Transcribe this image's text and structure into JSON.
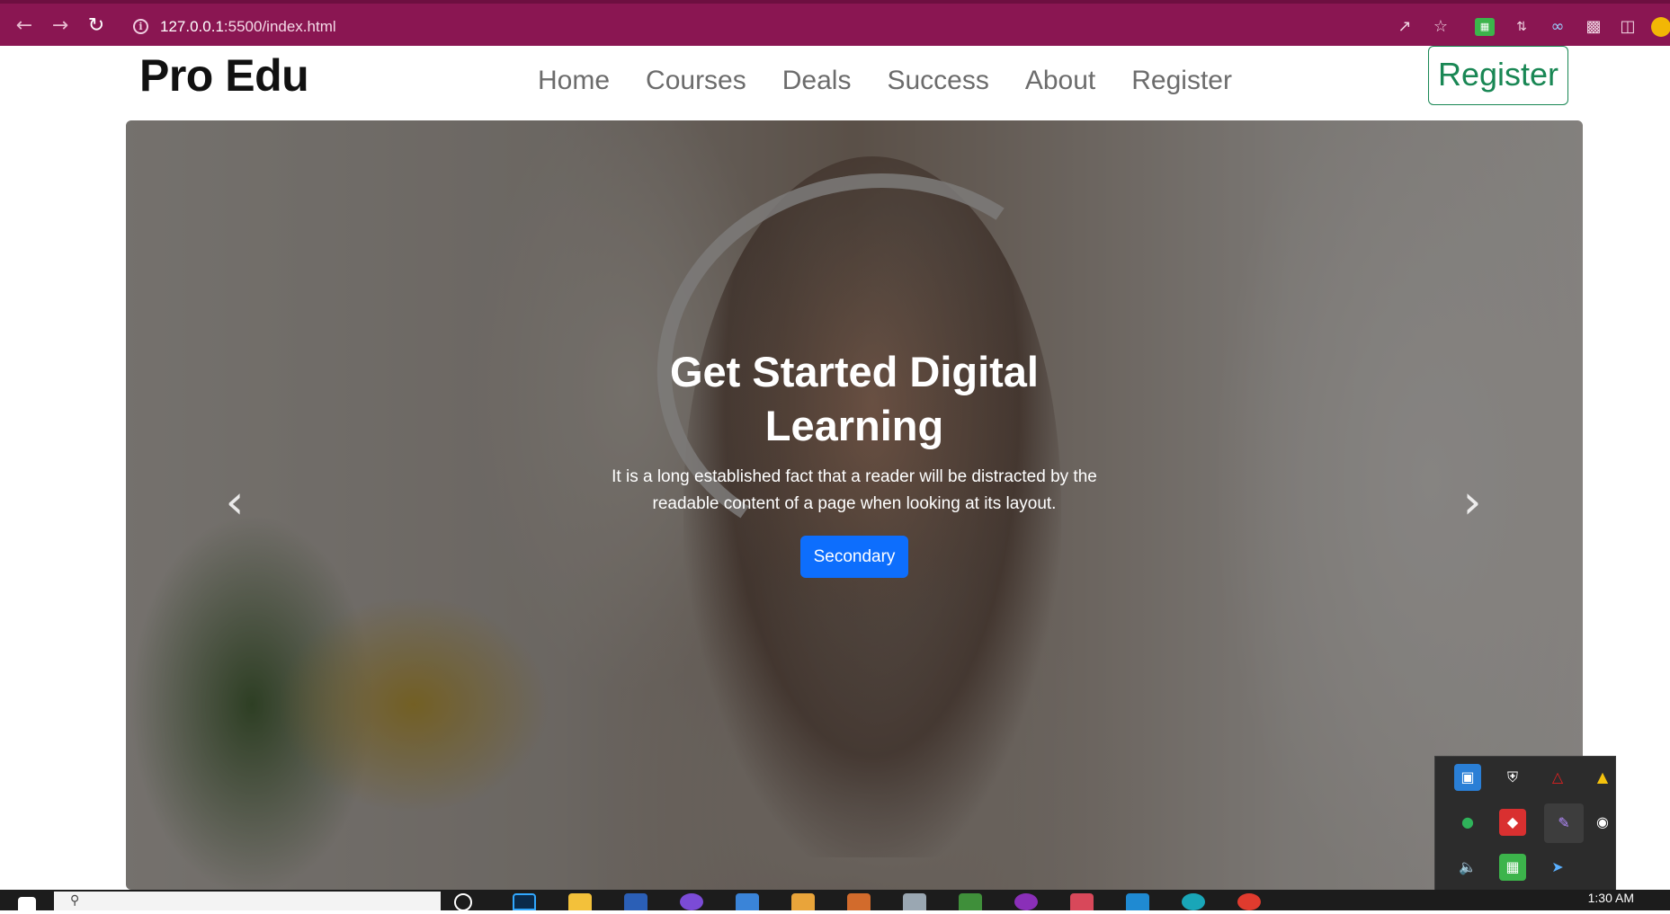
{
  "browser": {
    "url_host": "127.0.0.1",
    "url_path": ":5500/index.html"
  },
  "site": {
    "brand": "Pro Edu",
    "nav": [
      "Home",
      "Courses",
      "Deals",
      "Success",
      "About",
      "Register"
    ],
    "register_button": "Register"
  },
  "hero": {
    "title": "Get Started Digital Learning",
    "text": "It is a long established fact that a reader will be distracted by the readable content of a page when looking at its layout.",
    "button": "Secondary",
    "prev_icon": "chevron-left-icon",
    "next_icon": "chevron-right-icon"
  },
  "taskbar": {
    "time": "1:30 AM"
  },
  "colors": {
    "chrome_bar": "#8a1652",
    "register_green": "#198754",
    "button_blue": "#0d6efd"
  }
}
